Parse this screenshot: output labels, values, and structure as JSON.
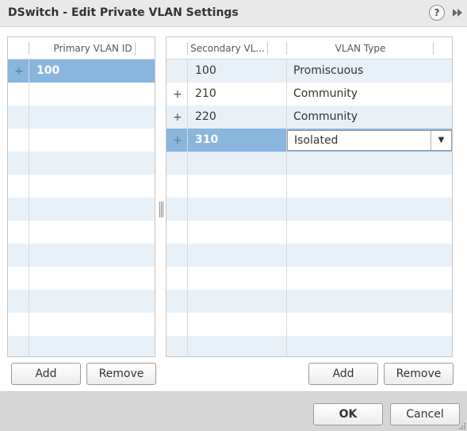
{
  "dialog": {
    "title": "DSwitch - Edit Private VLAN Settings",
    "help_glyph": "?"
  },
  "primary": {
    "column_header": "Primary VLAN ID",
    "rows": [
      {
        "value": "100",
        "selected": true,
        "expandable": true
      }
    ],
    "add_label": "Add",
    "remove_label": "Remove"
  },
  "secondary": {
    "column_headers": [
      "Secondary VL...",
      "VLAN Type"
    ],
    "rows": [
      {
        "id": "100",
        "type": "Promiscuous",
        "expandable": false,
        "selected": false
      },
      {
        "id": "210",
        "type": "Community",
        "expandable": true,
        "selected": false
      },
      {
        "id": "220",
        "type": "Community",
        "expandable": true,
        "selected": false
      },
      {
        "id": "310",
        "type": "Isolated",
        "expandable": true,
        "selected": true
      }
    ],
    "type_select": {
      "selected": "Isolated"
    },
    "add_label": "Add",
    "remove_label": "Remove"
  },
  "footer": {
    "ok_label": "OK",
    "cancel_label": "Cancel"
  },
  "colors": {
    "selected_row": "#88b6dd",
    "alternate_row": "#e9f1f8",
    "titlebar": "#e9e9e9",
    "footer": "#d6d6d6"
  },
  "icons": [
    "help-icon",
    "forward-icon",
    "expand-icon",
    "resize-grip-icon",
    "dropdown-arrow-icon"
  ]
}
